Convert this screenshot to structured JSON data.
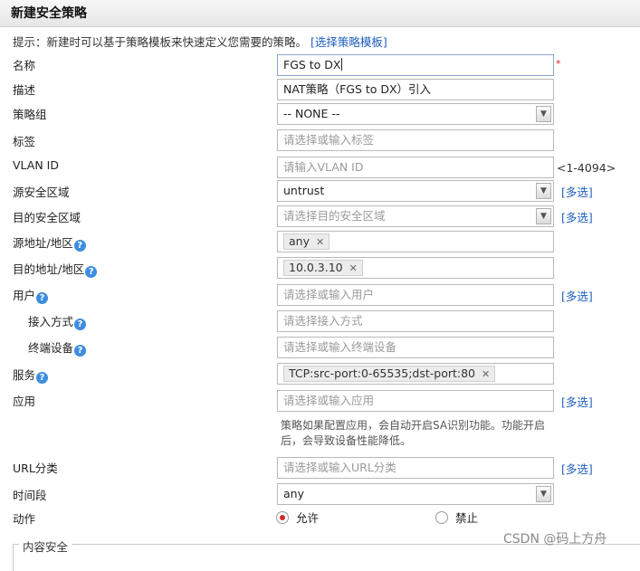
{
  "dialog": {
    "title": "新建安全策略"
  },
  "hint": {
    "text": "提示：新建时可以基于策略模板来快速定义您需要的策略。",
    "link": "[选择策略模板]"
  },
  "form": {
    "name": {
      "label": "名称",
      "value": "FGS to DX",
      "required_mark": "*"
    },
    "description": {
      "label": "描述",
      "value": "NAT策略（FGS to DX）引入"
    },
    "policy_group": {
      "label": "策略组",
      "value": "-- NONE --"
    },
    "tag": {
      "label": "标签",
      "placeholder": "请选择或输入标签"
    },
    "vlan_id": {
      "label": "VLAN ID",
      "placeholder": "请输入VLAN ID",
      "range": "<1-4094>"
    },
    "source_zone": {
      "label": "源安全区域",
      "value": "untrust",
      "multi": "[多选]"
    },
    "dest_zone": {
      "label": "目的安全区域",
      "placeholder": "请选择目的安全区域",
      "multi": "[多选]"
    },
    "source_address": {
      "label": "源地址/地区",
      "tag": "any"
    },
    "dest_address": {
      "label": "目的地址/地区",
      "tag": "10.0.3.10"
    },
    "user": {
      "label": "用户",
      "placeholder": "请选择或输入用户",
      "multi": "[多选]"
    },
    "access_mode": {
      "label": "接入方式",
      "placeholder": "请选择接入方式"
    },
    "terminal_device": {
      "label": "终端设备",
      "placeholder": "请选择或输入终端设备"
    },
    "service": {
      "label": "服务",
      "tag": "TCP:src-port:0-65535;dst-port:80"
    },
    "application": {
      "label": "应用",
      "placeholder": "请选择或输入应用",
      "multi": "[多选]",
      "note_line1": "策略如果配置应用，会自动开启SA识别功能。功能开启",
      "note_line2": "后，会导致设备性能降低。"
    },
    "url_category": {
      "label": "URL分类",
      "placeholder": "请选择或输入URL分类",
      "multi": "[多选]"
    },
    "time_range": {
      "label": "时间段",
      "value": "any"
    },
    "action": {
      "label": "动作",
      "allow": "允许",
      "deny": "禁止",
      "selected": "allow"
    },
    "content_security": {
      "legend": "内容安全"
    }
  },
  "icons": {
    "help": "?",
    "remove": "✕",
    "dropdown": "▼"
  },
  "watermark": "CSDN @码上方舟",
  "colors": {
    "link": "#1f5fbf",
    "required": "#e02020",
    "radio_selected": "#d42a2a",
    "help_icon": "#3d8de0"
  }
}
